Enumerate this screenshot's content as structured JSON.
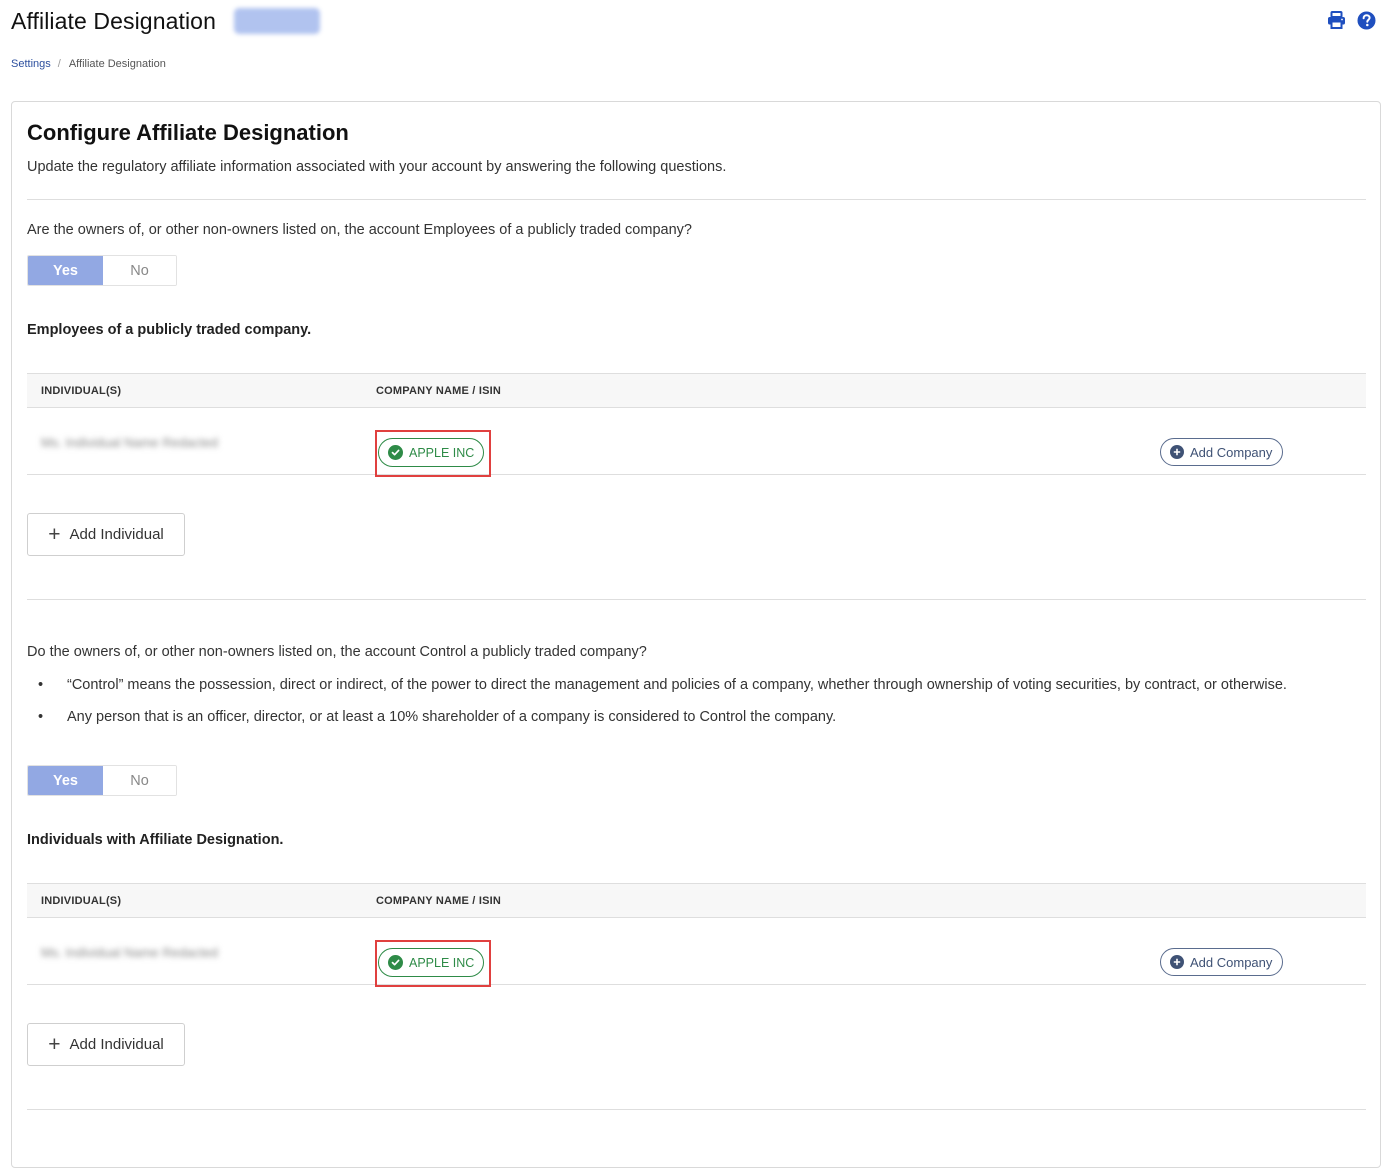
{
  "header": {
    "title": "Affiliate Designation",
    "badge_text": "",
    "print_icon": "print-icon",
    "help_icon": "help-icon",
    "accent": "#1f4fbf"
  },
  "breadcrumb": {
    "items": [
      {
        "label": "Settings",
        "link": true
      },
      {
        "label": "Affiliate Designation",
        "link": false
      }
    ],
    "separator": "/"
  },
  "card": {
    "title": "Configure Affiliate Designation",
    "description": "Update the regulatory affiliate information associated with your account by answering the following questions."
  },
  "sections": [
    {
      "question": "Are the owners of, or other non-owners listed on, the account Employees of a publicly traded company?",
      "toggle": {
        "yes": "Yes",
        "no": "No",
        "selected": "Yes"
      },
      "table_title": "Employees of a publicly traded company.",
      "columns": [
        "INDIVIDUAL(S)",
        "COMPANY NAME / ISIN"
      ],
      "rows": [
        {
          "individual": "",
          "company": "APPLE INC",
          "add_company": "Add Company"
        }
      ],
      "add_individual": "Add Individual"
    },
    {
      "question": "Do the owners of, or other non-owners listed on, the account Control a publicly traded company?",
      "bullets": [
        "“Control” means the possession, direct or indirect, of the power to direct the management and policies of a company, whether through ownership of voting securities, by contract, or otherwise.",
        "Any person that is an officer, director, or at least a 10% shareholder of a company is considered to Control the company."
      ],
      "toggle": {
        "yes": "Yes",
        "no": "No",
        "selected": "Yes"
      },
      "table_title": "Individuals with Affiliate Designation.",
      "columns": [
        "INDIVIDUAL(S)",
        "COMPANY NAME / ISIN"
      ],
      "rows": [
        {
          "individual": "",
          "company": "APPLE INC",
          "add_company": "Add Company"
        }
      ],
      "add_individual": "Add Individual"
    }
  ],
  "colors": {
    "toggle_selected": "#92a8e3",
    "company_verified": "#2e8b47",
    "highlight_box": "#e0403f",
    "link": "#2c4f9e"
  }
}
